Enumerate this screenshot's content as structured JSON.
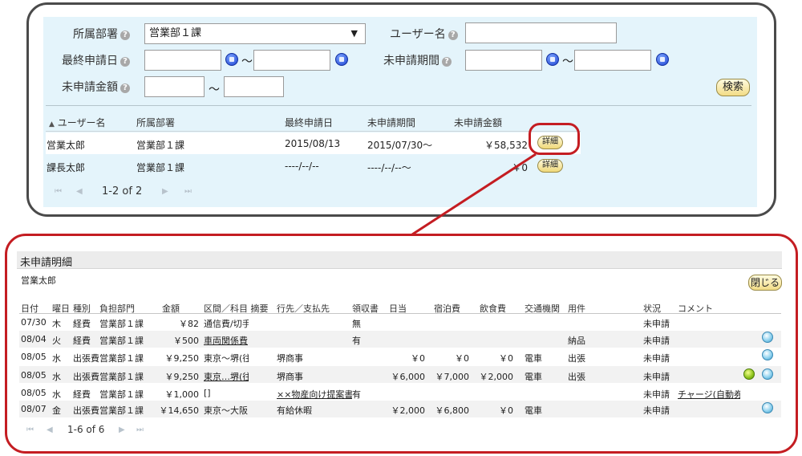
{
  "search": {
    "dept_label": "所属部署",
    "dept_value": "営業部１課",
    "dept_arrow": "▼",
    "username_label": "ユーザー名",
    "username_value": "",
    "last_apply_label": "最終申請日",
    "unapplied_period_label": "未申請期間",
    "unapplied_amount_label": "未申請金額",
    "range_sep": "～",
    "help_glyph": "?",
    "search_button": "検索"
  },
  "result_table": {
    "sort_indicator": "▲",
    "columns": [
      "ユーザー名",
      "所属部署",
      "最終申請日",
      "未申請期間",
      "未申請金額"
    ],
    "rows": [
      {
        "user": "営業太郎",
        "dept": "営業部１課",
        "last": "2015/08/13",
        "period": "2015/07/30～",
        "amount": "￥58,532",
        "detail": "詳細"
      },
      {
        "user": "課長太郎",
        "dept": "営業部１課",
        "last": "----/--/--",
        "period": "----/--/--～",
        "amount": "￥0",
        "detail": "詳細"
      }
    ],
    "pager": {
      "first": "⏮",
      "prev": "◀",
      "text": "1-2 of 2",
      "next": "▶",
      "last": "⏭"
    }
  },
  "detail": {
    "title": "未申請明細",
    "user": "営業太郎",
    "close_button": "閉じる",
    "columns": [
      "日付",
      "曜日",
      "種別",
      "負担部門",
      "金額",
      "区間／科目 摘要",
      "行先／支払先",
      "領収書",
      "日当",
      "宿泊費",
      "飲食費",
      "交通機関",
      "用件",
      "状況",
      "コメント"
    ],
    "rows": [
      {
        "date": "07/30",
        "dow": "木",
        "type": "経費",
        "dept": "営業部１課",
        "amount": "￥82",
        "route": "通信費/切手",
        "dest": "",
        "receipt": "無",
        "daily": "",
        "hotel": "",
        "meal": "",
        "transport": "",
        "purpose": "",
        "status": "未申請",
        "comment": ""
      },
      {
        "date": "08/04",
        "dow": "火",
        "type": "経費",
        "dept": "営業部１課",
        "amount": "￥500",
        "route": "車両関係費",
        "dest": "",
        "receipt": "有",
        "daily": "",
        "hotel": "",
        "meal": "",
        "transport": "",
        "purpose": "納品",
        "status": "未申請",
        "comment": ""
      },
      {
        "date": "08/05",
        "dow": "水",
        "type": "出張費",
        "dept": "営業部１課",
        "amount": "￥9,250",
        "route": "東京～堺(往",
        "dest": "堺商事",
        "receipt": "",
        "daily": "￥0",
        "hotel": "￥0",
        "meal": "￥0",
        "transport": "電車",
        "purpose": "出張",
        "status": "未申請",
        "comment": ""
      },
      {
        "date": "08/05",
        "dow": "水",
        "type": "出張費",
        "dept": "営業部１課",
        "amount": "￥9,250",
        "route": "東京…堺(往",
        "dest": "堺商事",
        "receipt": "",
        "daily": "￥6,000",
        "hotel": "￥7,000",
        "meal": "￥2,000",
        "transport": "電車",
        "purpose": "出張",
        "status": "未申請",
        "comment": ""
      },
      {
        "date": "08/05",
        "dow": "水",
        "type": "経費",
        "dept": "営業部１課",
        "amount": "￥1,000",
        "route": "[]",
        "dest": "××物産向け提案書作",
        "receipt": "有",
        "daily": "",
        "hotel": "",
        "meal": "",
        "transport": "",
        "purpose": "",
        "status": "未申請",
        "comment": "チャージ(自動券売"
      },
      {
        "date": "08/07",
        "dow": "金",
        "type": "出張費",
        "dept": "営業部１課",
        "amount": "￥14,650",
        "route": "東京～大阪",
        "dest": "有給休暇",
        "receipt": "",
        "daily": "￥2,000",
        "hotel": "￥6,800",
        "meal": "￥0",
        "transport": "電車",
        "purpose": "",
        "status": "未申請",
        "comment": ""
      }
    ],
    "pager": {
      "first": "⏮",
      "prev": "◀",
      "text": "1-6 of 6",
      "next": "▶",
      "last": "⏭"
    }
  },
  "colors": {
    "callout": "#c41d22",
    "panel_bg": "#e4f4fb",
    "frame": "#4a4a4a"
  }
}
